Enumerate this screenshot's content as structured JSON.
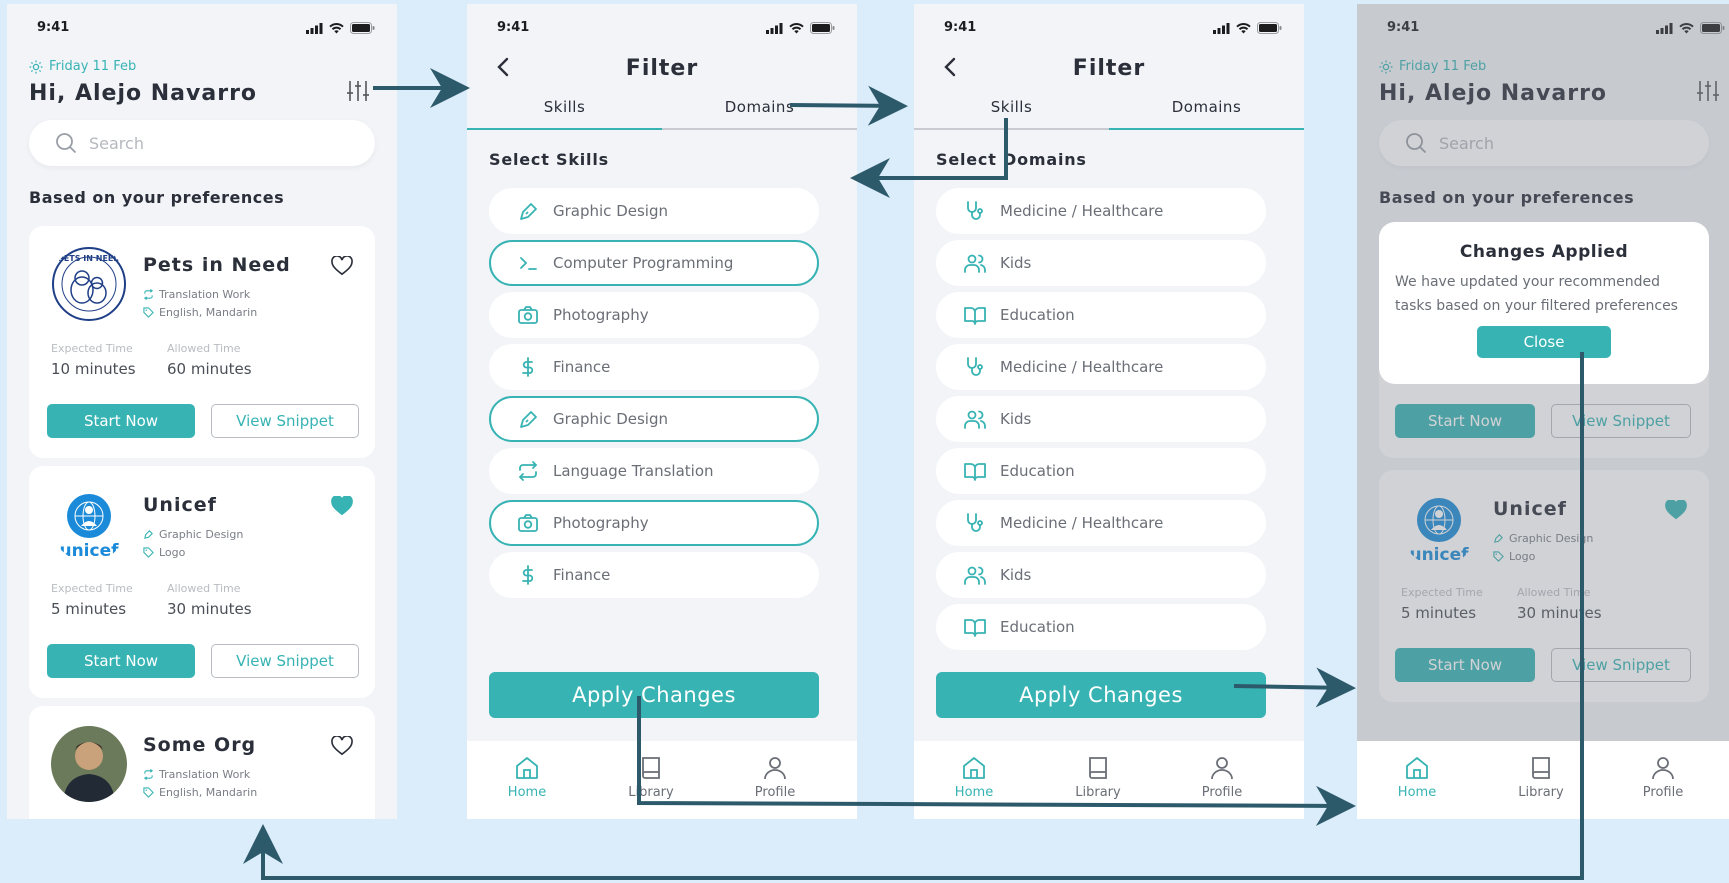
{
  "status": {
    "time": "9:41"
  },
  "home": {
    "date": "Friday 11 Feb",
    "greeting": "Hi, Alejo Navarro",
    "search_placeholder": "Search",
    "section_title": "Based on your preferences",
    "cards": [
      {
        "org": "Pets in Need",
        "tag1": "Translation Work",
        "tag2": "English, Mandarin",
        "expected_label": "Expected Time",
        "expected": "10 minutes",
        "allowed_label": "Allowed Time",
        "allowed": "60 minutes",
        "start": "Start Now",
        "snippet": "View Snippet",
        "favorite": false,
        "logo_text": "PETS IN NEED"
      },
      {
        "org": "Unicef",
        "tag1": "Graphic Design",
        "tag2": "Logo",
        "expected_label": "Expected Time",
        "expected": "5 minutes",
        "allowed_label": "Allowed Time",
        "allowed": "30 minutes",
        "start": "Start Now",
        "snippet": "View Snippet",
        "favorite": true,
        "logo_text": "unicef"
      },
      {
        "org": "Some Org",
        "tag1": "Translation Work",
        "tag2": "English, Mandarin",
        "favorite": false
      }
    ]
  },
  "filter": {
    "title": "Filter",
    "tabs": [
      "Skills",
      "Domains"
    ],
    "skills_title": "Select Skills",
    "domains_title": "Select Domains",
    "skills": [
      {
        "label": "Graphic Design",
        "icon": "pen-icon",
        "selected": false
      },
      {
        "label": "Computer Programming",
        "icon": "terminal-icon",
        "selected": true
      },
      {
        "label": "Photography",
        "icon": "camera-icon",
        "selected": false
      },
      {
        "label": "Finance",
        "icon": "dollar-icon",
        "selected": false
      },
      {
        "label": "Graphic Design",
        "icon": "pen-icon",
        "selected": true
      },
      {
        "label": "Language Translation",
        "icon": "repeat-icon",
        "selected": false
      },
      {
        "label": "Photography",
        "icon": "camera-icon",
        "selected": true
      },
      {
        "label": "Finance",
        "icon": "dollar-icon",
        "selected": false
      }
    ],
    "domains": [
      {
        "label": "Medicine / Healthcare",
        "icon": "stethoscope-icon"
      },
      {
        "label": "Kids",
        "icon": "users-icon"
      },
      {
        "label": "Education",
        "icon": "book-open-icon"
      },
      {
        "label": "Medicine / Healthcare",
        "icon": "stethoscope-icon"
      },
      {
        "label": "Kids",
        "icon": "users-icon"
      },
      {
        "label": "Education",
        "icon": "book-open-icon"
      },
      {
        "label": "Medicine / Healthcare",
        "icon": "stethoscope-icon"
      },
      {
        "label": "Kids",
        "icon": "users-icon"
      },
      {
        "label": "Education",
        "icon": "book-open-icon"
      }
    ],
    "apply": "Apply Changes"
  },
  "modal": {
    "title": "Changes Applied",
    "text": "We have updated your recommended tasks based on your filtered preferences",
    "close": "Close"
  },
  "tabbar": {
    "home": "Home",
    "library": "Library",
    "profile": "Profile"
  },
  "colors": {
    "accent": "#37b3b3",
    "arrow": "#2d5a6a",
    "background": "#dbecfb"
  }
}
